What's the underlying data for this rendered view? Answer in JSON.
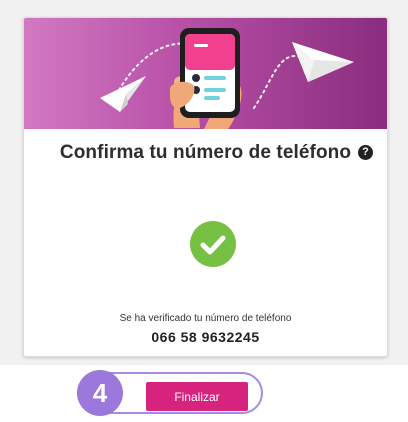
{
  "card": {
    "title": "Confirma tu número de teléfono",
    "help_icon": "question-circle-icon",
    "status_icon": "check-circle-icon",
    "verified_message": "Se ha verificado tu número de teléfono",
    "phone_number": "066 58 9632245"
  },
  "footer": {
    "step_number": "4",
    "finish_label": "Finalizar"
  },
  "colors": {
    "brand_primary": "#d6237d",
    "success": "#76c043",
    "step_accent": "#9c78dd",
    "hero_gradient_start": "#d279c2",
    "hero_gradient_end": "#8a2d7e"
  }
}
